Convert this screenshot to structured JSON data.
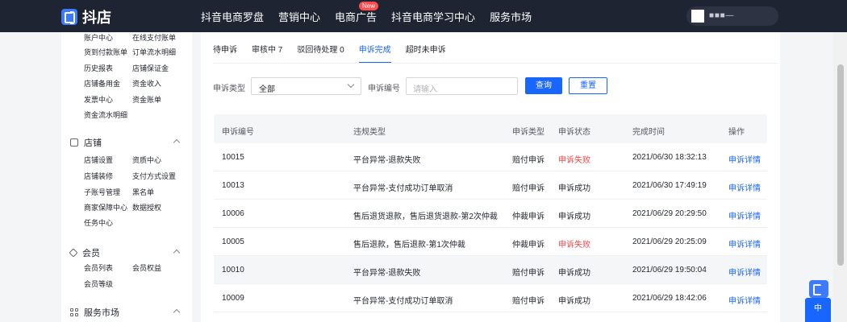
{
  "app": {
    "logo_text": "抖店"
  },
  "nav": [
    {
      "label": "抖音电商罗盘"
    },
    {
      "label": "营销中心"
    },
    {
      "label": "电商广告",
      "badge": "New"
    },
    {
      "label": "抖音电商学习中心"
    },
    {
      "label": "服务市场"
    }
  ],
  "top_icons": [
    "phone-icon",
    "message-icon",
    "bell-icon"
  ],
  "user": {
    "name": "■ ■ ■   —"
  },
  "sidebar": {
    "links_top": [
      {
        "left": "账户中心",
        "right": "在线支付账单"
      },
      {
        "left": "货到付款账单",
        "right": "订单流水明细"
      },
      {
        "left": "历史报表",
        "right": "店铺保证金"
      },
      {
        "left": "店铺备用金",
        "right": "资金收入"
      },
      {
        "left": "发票中心",
        "right": "资金账单"
      },
      {
        "left": "资金流水明细",
        "right": ""
      }
    ],
    "group_store": {
      "title": "店铺",
      "links": [
        {
          "left": "店铺设置",
          "right": "资质中心"
        },
        {
          "left": "店铺装修",
          "right": "支付方式设置"
        },
        {
          "left": "子账号管理",
          "right": "黑名单"
        },
        {
          "left": "商家保障中心",
          "right": "数据授权"
        },
        {
          "left": "任务中心",
          "right": ""
        }
      ]
    },
    "group_member": {
      "title": "会员",
      "links": [
        {
          "left": "会员列表",
          "right": "会员权益"
        },
        {
          "left": "会员等级",
          "right": ""
        }
      ]
    },
    "group_market": {
      "title": "服务市场"
    }
  },
  "tabs": [
    {
      "label": "待申诉",
      "active": false
    },
    {
      "label": "审核中 7",
      "active": false
    },
    {
      "label": "驳回待处理 0",
      "active": false
    },
    {
      "label": "申诉完成",
      "active": true
    },
    {
      "label": "超时未申诉",
      "active": false
    }
  ],
  "filters": {
    "type_label": "申诉类型",
    "type_value": "全部",
    "id_label": "申诉编号",
    "id_placeholder": "请输入",
    "query_button": "查询",
    "reset_button": "重置"
  },
  "table": {
    "headers": [
      "申诉编号",
      "违规类型",
      "申诉类型",
      "申诉状态",
      "完成时间",
      "操作"
    ],
    "rows": [
      {
        "id": "10015",
        "violation": "平台异常-退款失败",
        "type": "赔付申诉",
        "status": "申诉失败",
        "fail": true,
        "time": "2021/06/30 18:32:13",
        "action": "申诉详情"
      },
      {
        "id": "10013",
        "violation": "平台异常-支付成功订单取消",
        "type": "赔付申诉",
        "status": "申诉成功",
        "fail": false,
        "time": "2021/06/30 17:49:19",
        "action": "申诉详情"
      },
      {
        "id": "10006",
        "violation": "售后退货退款，售后退货退款-第2次仲裁",
        "type": "仲裁申诉",
        "status": "申诉成功",
        "fail": false,
        "time": "2021/06/29 20:29:50",
        "action": "申诉详情"
      },
      {
        "id": "10005",
        "violation": "售后退款，售后退款-第1次仲裁",
        "type": "仲裁申诉",
        "status": "申诉失败",
        "fail": true,
        "time": "2021/06/29 20:25:09",
        "action": "申诉详情"
      },
      {
        "id": "10010",
        "violation": "平台异常-退款失败",
        "type": "赔付申诉",
        "status": "申诉成功",
        "fail": false,
        "time": "2021/06/29 19:50:04",
        "action": "申诉详情"
      },
      {
        "id": "10009",
        "violation": "平台异常-支付成功订单取消",
        "type": "赔付申诉",
        "status": "申诉成功",
        "fail": false,
        "time": "2021/06/29 18:42:06",
        "action": "申诉详情"
      }
    ]
  },
  "float": {
    "button_label": "中"
  },
  "colors": {
    "primary": "#1966ff",
    "fail": "#f24747",
    "topbar": "#1f2432"
  }
}
